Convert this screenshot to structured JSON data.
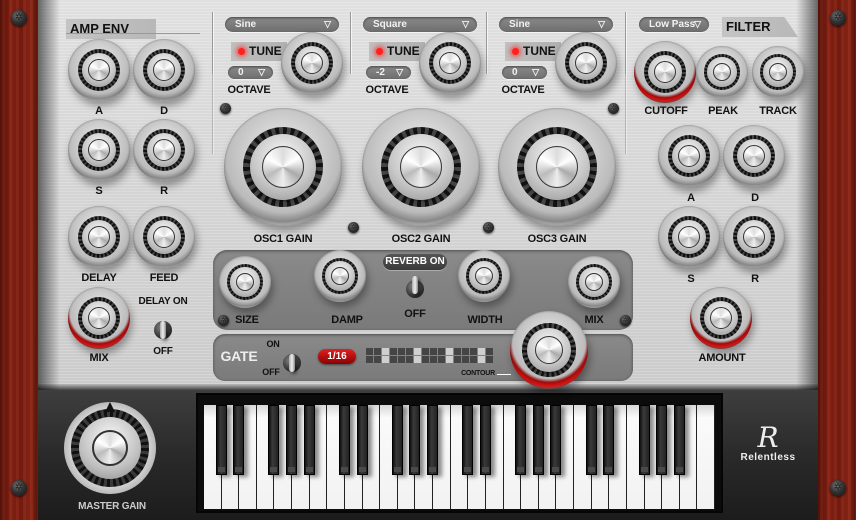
{
  "amp_env": {
    "title": "AMP ENV",
    "knobs": [
      {
        "label": "A",
        "value": 0.05
      },
      {
        "label": "D",
        "value": 0.9
      },
      {
        "label": "S",
        "value": 0.5
      },
      {
        "label": "R",
        "value": 0.5
      }
    ]
  },
  "delay": {
    "delay_label": "DELAY",
    "feed_label": "FEED",
    "mix_label": "MIX",
    "switch_on_label": "DELAY ON",
    "switch_off_label": "OFF",
    "switch_state": "off"
  },
  "oscillators": [
    {
      "waveform": "Sine",
      "tune_label": "TUNE",
      "octave_value": "0",
      "octave_label": "OCTAVE",
      "gain_label": "OSC1 GAIN",
      "gain": 0.05
    },
    {
      "waveform": "Square",
      "tune_label": "TUNE",
      "octave_value": "-2",
      "octave_label": "OCTAVE",
      "gain_label": "OSC2 GAIN",
      "gain": 0.95
    },
    {
      "waveform": "Sine",
      "tune_label": "TUNE",
      "octave_value": "0",
      "octave_label": "OCTAVE",
      "gain_label": "OSC3 GAIN",
      "gain": 0.05
    }
  ],
  "reverb": {
    "size_label": "SIZE",
    "damp_label": "DAMP",
    "width_label": "WIDTH",
    "mix_label": "MIX",
    "switch_on_label": "REVERB ON",
    "switch_off_label": "OFF",
    "switch_state": "off"
  },
  "gate": {
    "title": "GATE",
    "on_label": "ON",
    "off_label": "OFF",
    "rate": "1/16",
    "contour_label": "CONTOUR",
    "steps": [
      0,
      0,
      1,
      0,
      0,
      0,
      1,
      0,
      0,
      0,
      1,
      0,
      0,
      0,
      1,
      0
    ]
  },
  "filter": {
    "title": "FILTER",
    "type": "Low Pass",
    "cutoff_label": "CUTOFF",
    "peak_label": "PEAK",
    "track_label": "TRACK",
    "env_labels": [
      "A",
      "D",
      "S",
      "R"
    ],
    "amount_label": "AMOUNT"
  },
  "master": {
    "label": "MASTER GAIN",
    "value": 0.5
  },
  "brand": {
    "glyph": "R",
    "name": "Relentless"
  },
  "icons": {
    "dropdown_arrow": "▽"
  }
}
